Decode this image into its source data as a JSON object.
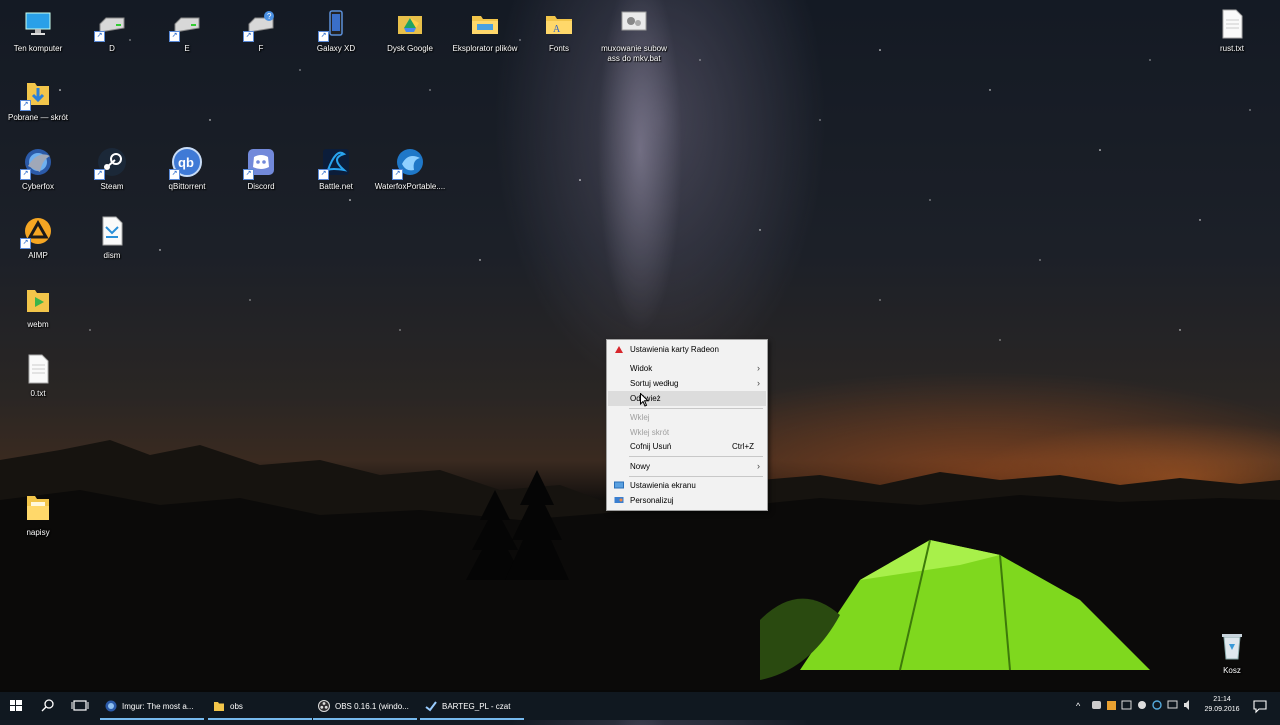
{
  "desktop": {
    "icons": [
      {
        "label": "Ten komputer",
        "icon": "monitor-icon"
      },
      {
        "label": "D",
        "icon": "drive-icon"
      },
      {
        "label": "E",
        "icon": "drive-icon"
      },
      {
        "label": "F",
        "icon": "drive-icon"
      },
      {
        "label": "Galaxy XD",
        "icon": "phone-icon"
      },
      {
        "label": "Dysk Google",
        "icon": "google-drive-icon"
      },
      {
        "label": "Eksplorator plików",
        "icon": "folder-icon"
      },
      {
        "label": "Fonts",
        "icon": "folder-icon"
      },
      {
        "label": "muxowanie subow ass do mkv.bat",
        "icon": "batch-file-icon"
      },
      {
        "label": "rust.txt",
        "icon": "text-file-icon"
      },
      {
        "label": "Pobrane — skrót",
        "icon": "downloads-folder-icon"
      },
      {
        "label": "Cyberfox",
        "icon": "cyberfox-icon"
      },
      {
        "label": "Steam",
        "icon": "steam-icon"
      },
      {
        "label": "qBittorrent",
        "icon": "qbittorrent-icon"
      },
      {
        "label": "Discord",
        "icon": "discord-icon"
      },
      {
        "label": "Battle.net",
        "icon": "battlenet-icon"
      },
      {
        "label": "WaterfoxPortable....",
        "icon": "waterfox-icon"
      },
      {
        "label": "AIMP",
        "icon": "aimp-icon"
      },
      {
        "label": "dism",
        "icon": "script-file-icon"
      },
      {
        "label": "webm",
        "icon": "video-folder-icon"
      },
      {
        "label": "0.txt",
        "icon": "text-file-icon"
      },
      {
        "label": "napisy",
        "icon": "folder-icon"
      },
      {
        "label": "Kosz",
        "icon": "recycle-bin-icon"
      }
    ]
  },
  "context_menu": {
    "items": [
      {
        "label": "Ustawienia karty Radeon",
        "icon": "radeon-icon",
        "enabled": true
      },
      {
        "label": "Widok",
        "submenu": true,
        "enabled": true
      },
      {
        "label": "Sortuj według",
        "submenu": true,
        "enabled": true
      },
      {
        "label": "Odśwież",
        "enabled": true,
        "highlighted": true
      },
      {
        "label": "Wklej",
        "enabled": false
      },
      {
        "label": "Wklej skrót",
        "enabled": false
      },
      {
        "label": "Cofnij Usuń",
        "shortcut": "Ctrl+Z",
        "enabled": true
      },
      {
        "label": "Nowy",
        "submenu": true,
        "enabled": true
      },
      {
        "label": "Ustawienia ekranu",
        "icon": "display-settings-icon",
        "enabled": true
      },
      {
        "label": "Personalizuj",
        "icon": "personalize-icon",
        "enabled": true
      }
    ]
  },
  "taskbar": {
    "apps": [
      {
        "label": "Imgur: The most a...",
        "icon": "browser-icon"
      },
      {
        "label": "obs",
        "icon": "folder-icon"
      },
      {
        "label": "OBS 0.16.1 (windo...",
        "icon": "obs-icon"
      },
      {
        "label": "BARTEG_PL - czat",
        "icon": "steam-chat-icon"
      }
    ],
    "clock": {
      "time": "21:14",
      "date": "29.09.2016"
    }
  },
  "colors": {
    "taskbar_bg": "#101820",
    "menu_bg": "#f2f2f2",
    "active_indicator": "#76b9ed",
    "tent_green": "#7fd81e"
  }
}
